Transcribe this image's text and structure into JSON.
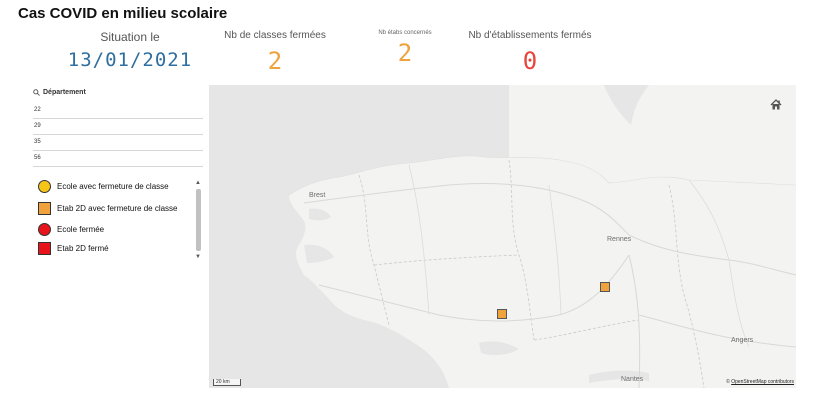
{
  "page": {
    "title": "Cas COVID en milieu scolaire"
  },
  "kpis": {
    "situation": {
      "label": "Situation le",
      "value": "13/01/2021"
    },
    "classes": {
      "label": "Nb de classes fermées",
      "value": "2",
      "color": "#f0a23c"
    },
    "etabs": {
      "label": "Nb étabs concernés",
      "value": "2",
      "color": "#f0a23c"
    },
    "fermes": {
      "label": "Nb d'établissements fermés",
      "value": "0",
      "color": "#e8443a"
    }
  },
  "department_filter": {
    "icon": "search-icon",
    "header": "Département",
    "items": [
      "22",
      "29",
      "35",
      "56"
    ]
  },
  "legend": {
    "items": [
      {
        "shape": "circle",
        "color": "#f5c518",
        "label": "Ecole avec fermeture de classe"
      },
      {
        "shape": "square",
        "color": "#f0a23c",
        "label": "Etab 2D avec fermeture de classe"
      },
      {
        "shape": "circle",
        "color": "#e8141b",
        "label": "Ecole fermée"
      },
      {
        "shape": "square",
        "color": "#e8141b",
        "label": "Etab 2D fermé"
      }
    ]
  },
  "map": {
    "cities": [
      "Brest",
      "Rennes",
      "Angers",
      "Nantes"
    ],
    "scale_label": "20 km",
    "attribution_prefix": "© ",
    "attribution_link": "OpenStreetMap contributors",
    "home_icon": "home-icon",
    "markers": [
      {
        "type": "Etab 2D avec fermeture de classe",
        "color": "#f0a23c"
      },
      {
        "type": "Etab 2D avec fermeture de classe",
        "color": "#f0a23c"
      }
    ]
  }
}
